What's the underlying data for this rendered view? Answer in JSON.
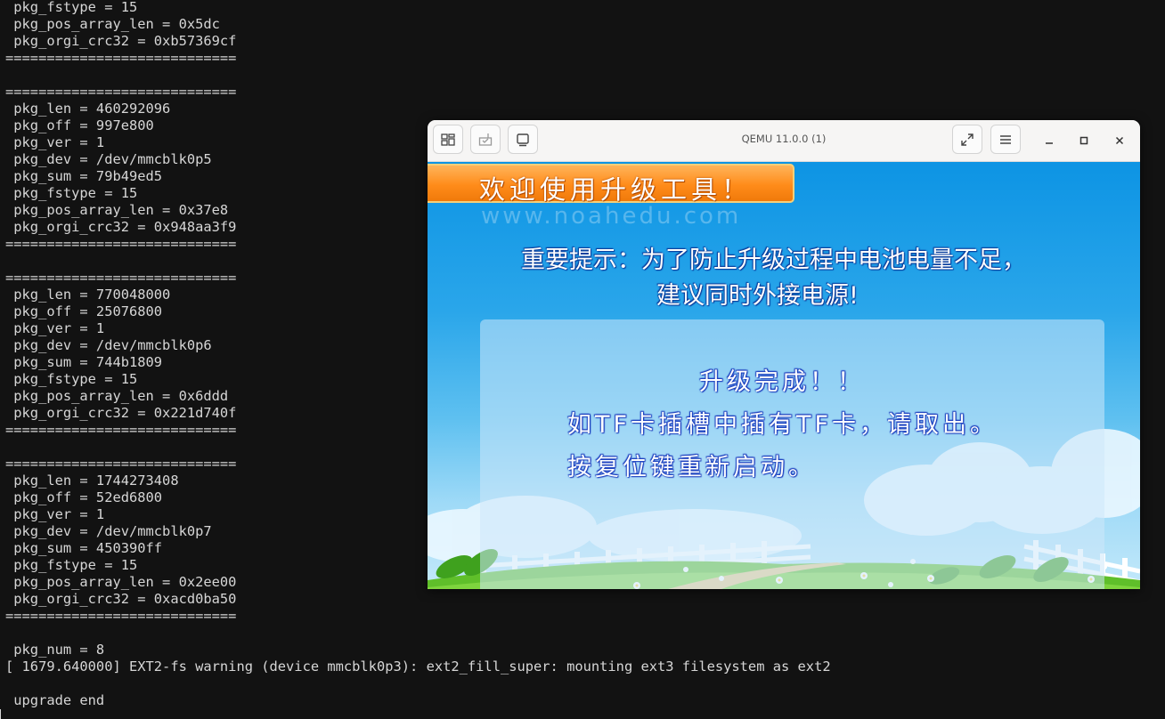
{
  "terminal": {
    "lines": [
      " pkg_fstype = 15",
      " pkg_pos_array_len = 0x5dc",
      " pkg_orgi_crc32 = 0xb57369cf",
      "============================",
      "",
      "============================",
      " pkg_len = 460292096",
      " pkg_off = 997e800",
      " pkg_ver = 1",
      " pkg_dev = /dev/mmcblk0p5",
      " pkg_sum = 79b49ed5",
      " pkg_fstype = 15",
      " pkg_pos_array_len = 0x37e8",
      " pkg_orgi_crc32 = 0x948aa3f9",
      "============================",
      "",
      "============================",
      " pkg_len = 770048000",
      " pkg_off = 25076800",
      " pkg_ver = 1",
      " pkg_dev = /dev/mmcblk0p6",
      " pkg_sum = 744b1809",
      " pkg_fstype = 15",
      " pkg_pos_array_len = 0x6ddd",
      " pkg_orgi_crc32 = 0x221d740f",
      "============================",
      "",
      "============================",
      " pkg_len = 1744273408",
      " pkg_off = 52ed6800",
      " pkg_ver = 1",
      " pkg_dev = /dev/mmcblk0p7",
      " pkg_sum = 450390ff",
      " pkg_fstype = 15",
      " pkg_pos_array_len = 0x2ee00",
      " pkg_orgi_crc32 = 0xacd0ba50",
      "============================",
      "",
      " pkg_num = 8",
      "[ 1679.640000] EXT2-fs warning (device mmcblk0p3): ext2_fill_super: mounting ext3 filesystem as ext2",
      "",
      " upgrade end"
    ]
  },
  "qemu": {
    "title": "QEMU 11.0.0 (1)",
    "icons": {
      "view": "tabs-overview-icon",
      "keyboard": "input-grab-icon",
      "display": "display-icon",
      "fullscreen": "fullscreen-icon",
      "menu": "hamburger-menu-icon",
      "minimize": "minimize-icon",
      "maximize": "maximize-icon",
      "close": "close-icon"
    }
  },
  "guest": {
    "banner": "欢迎使用升级工具！",
    "website": "www.noahedu.com",
    "notice_line1": "重要提示：为了防止升级过程中电池电量不足，",
    "notice_line2": "建议同时外接电源!",
    "status_line1": "升级完成！！",
    "status_line2": "如TF卡插槽中插有TF卡，请取出。",
    "status_line3": "按复位键重新启动。"
  },
  "colors": {
    "terminal_bg": "#121212",
    "terminal_fg": "#d6d6d6",
    "banner_orange": "#ff8c1a",
    "sky_blue": "#0d94e4",
    "grass_green": "#5fbf2a"
  }
}
